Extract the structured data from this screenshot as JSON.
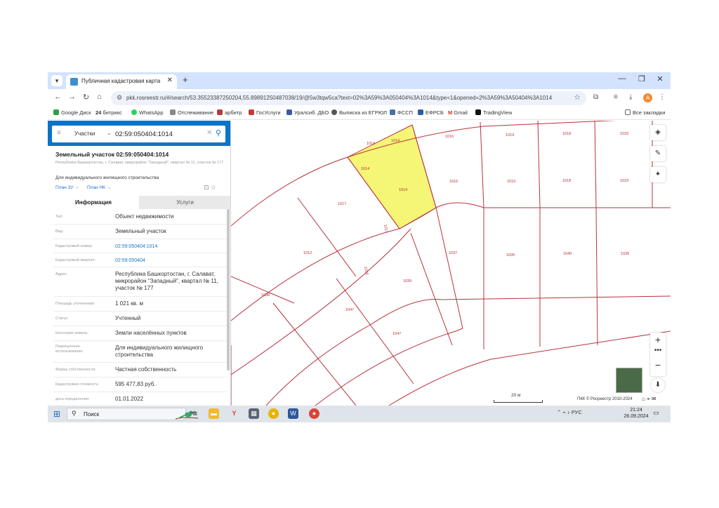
{
  "browser": {
    "tab_title": "Публичная кадастровая карта",
    "url": "pkk.rosreestr.ru/#/search/53.3552338725020​4,55.89891250487038/19/@5w3tqw5ca?text=02%3A59%3A050404%3A1014&type=1&opened=2%3A59%3A50404%3A1014",
    "avatar_letter": "A",
    "bookmarks": [
      "Google Диск",
      "битрикс",
      "WhatsApp",
      "Отслеживание",
      "арбитр",
      "ГосУслуги",
      "Уралсиб. ДБО",
      "Выписка из ЕГРЮЛ",
      "ФССП",
      "ЕФРСБ",
      "Gmail",
      "TradingView"
    ],
    "bookmarks_all": "Все закладки"
  },
  "search": {
    "category": "Участки",
    "query": "02:59:050404:1014"
  },
  "parcel": {
    "title": "Земельный участок 02:59:050404:1014",
    "address_short": "Республика Башкортостан, г. Салават, микрорайон \"Западный\", квартал № 11, участок № 177",
    "use": "Для индивидуального жилищного строительства",
    "plan_zu": "План ЗУ →",
    "plan_nk": "План НК →"
  },
  "tabs": {
    "info": "Информация",
    "services": "Услуги"
  },
  "info_rows": [
    {
      "label": "Тип:",
      "value": "Объект недвижимости",
      "link": false
    },
    {
      "label": "Вид:",
      "value": "Земельный участок",
      "link": false
    },
    {
      "label": "Кадастровый номер:",
      "value": "02:59:050404:1014",
      "link": true
    },
    {
      "label": "Кадастровый квартал:",
      "value": "02:59:050404",
      "link": true
    },
    {
      "label": "Адрес:",
      "value": "Республика Башкортостан, г. Салават, микрорайон \"Западный\", квартал № 11, участок № 177",
      "link": false
    },
    {
      "label": "Площадь уточненная:",
      "value": "1 021 кв. м",
      "link": false
    },
    {
      "label": "Статус:",
      "value": "Учтенный",
      "link": false
    },
    {
      "label": "Категория земель:",
      "value": "Земли населённых пунктов",
      "link": false
    },
    {
      "label": "Разрешенное использование:",
      "value": "Для индивидуального жилищного строительства",
      "link": false
    },
    {
      "label": "Форма собственности:",
      "value": "Частная собственность",
      "link": false
    },
    {
      "label": "Кадастровая стоимость:",
      "value": "595 477,83 руб.",
      "link": false
    },
    {
      "label": "дата определения:",
      "value": "01.01.2022",
      "link": false
    }
  ],
  "map": {
    "parcel_labels": {
      "p1014a": "1014",
      "p1014b": "1014",
      "p1014c": "1014",
      "p1014d": "1014",
      "p1014e": "1014",
      "p1016a": "1016",
      "p1016b": "1016",
      "p1019a": "1019",
      "p1019b": "1019",
      "p1018a": "1018",
      "p1018b": "1018",
      "p1023a": "1023",
      "p1023b": "1023",
      "p1017a": "1017",
      "p1017b": "1017",
      "p1012": "1012",
      "p1039": "1039",
      "p1036": "1036",
      "p1037": "1037",
      "p1026": "1026",
      "p1040": "1040",
      "p1035": "1035",
      "p1038": "1038",
      "p1047a": "1047",
      "p1047b": "1047"
    },
    "scale": "20 м",
    "copyright": "ПКК © Росреестр 2010-2024",
    "highlight_color": "#f5f576",
    "boundary_color": "#b8323c"
  },
  "taskbar": {
    "search_placeholder": "Поиск",
    "language": "РУС",
    "time": "21:24",
    "date": "26.09.2024"
  }
}
